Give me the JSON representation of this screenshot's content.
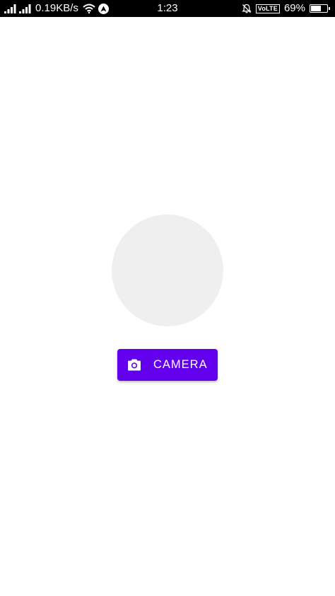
{
  "status_bar": {
    "net_speed": "0.19KB/s",
    "time": "1:23",
    "volte": "VoLTE",
    "battery_percent": "69%",
    "battery_level": 0.69,
    "icons": [
      "signal-icon",
      "wifi-icon",
      "navigation-icon",
      "bell-muted-icon",
      "battery-icon"
    ]
  },
  "main": {
    "camera_button_label": "CAMERA",
    "camera_button_icon": "camera-icon"
  },
  "colors": {
    "accent": "#6200ee",
    "placeholder": "#efefef",
    "status_bar": "#000000"
  }
}
